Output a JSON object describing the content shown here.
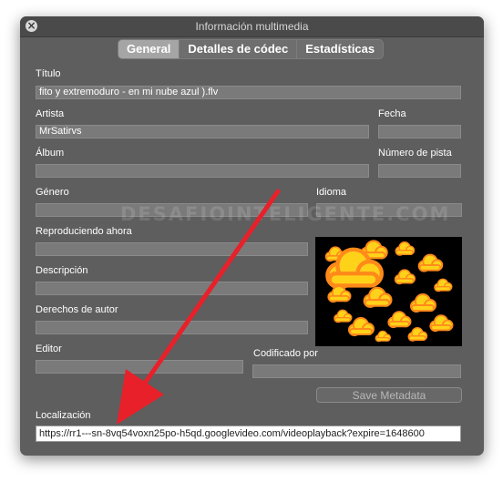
{
  "window": {
    "title": "Información multimedia"
  },
  "tabs": [
    "General",
    "Detalles de códec",
    "Estadísticas"
  ],
  "fields": {
    "titulo": {
      "label": "Título",
      "value": "fito y extremoduro - en mi nube azul ).flv"
    },
    "artista": {
      "label": "Artista",
      "value": "MrSatirvs"
    },
    "fecha": {
      "label": "Fecha",
      "value": ""
    },
    "album": {
      "label": "Álbum",
      "value": ""
    },
    "numero_pista": {
      "label": "Número de pista",
      "value": ""
    },
    "genero": {
      "label": "Género",
      "value": ""
    },
    "idioma": {
      "label": "Idioma",
      "value": ""
    },
    "reproduciendo": {
      "label": "Reproduciendo ahora",
      "value": ""
    },
    "descripcion": {
      "label": "Descripción",
      "value": ""
    },
    "derechos": {
      "label": "Derechos de autor",
      "value": ""
    },
    "editor": {
      "label": "Editor",
      "value": ""
    },
    "codificado": {
      "label": "Codificado por",
      "value": ""
    },
    "localizacion": {
      "label": "Localización",
      "value": "https://rr1---sn-8vq54voxn25po-h5qd.googlevideo.com/videoplayback?expire=1648600"
    }
  },
  "buttons": {
    "save_metadata": "Save Metadata"
  },
  "watermark": "DESAFIOINTELIGENTE.COM",
  "colors": {
    "arrow": "#e8202a",
    "cloud": "#ffd21a",
    "cloud_edge": "#ff8a1a",
    "window_bg": "#5e5e5e"
  }
}
